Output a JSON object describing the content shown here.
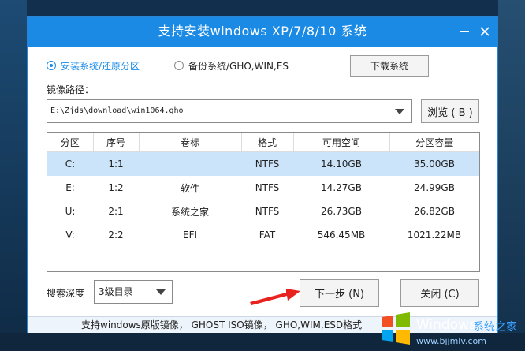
{
  "window": {
    "title": "支持安装windows XP/7/8/10 系统"
  },
  "options": {
    "restore_label": "安装系统/还原分区",
    "backup_label": "备份系统/GHO,WIN,ES",
    "selected": "restore",
    "download_button": "下载系统"
  },
  "image_path": {
    "label": "镜像路径：",
    "value": "E:\\Zjds\\download\\win1064.gho",
    "browse_button": "浏览 ( B )"
  },
  "table": {
    "headers": [
      "分区",
      "序号",
      "卷标",
      "格式",
      "可用空间",
      "分区容量"
    ],
    "rows": [
      [
        "C:",
        "1:1",
        "",
        "NTFS",
        "14.10GB",
        "35.00GB"
      ],
      [
        "E:",
        "1:2",
        "软件",
        "NTFS",
        "14.27GB",
        "24.99GB"
      ],
      [
        "U:",
        "2:1",
        "系统之家",
        "NTFS",
        "26.73GB",
        "26.82GB"
      ],
      [
        "V:",
        "2:2",
        "EFI",
        "FAT",
        "546.45MB",
        "1021.22MB"
      ]
    ],
    "selected_row": 0
  },
  "search": {
    "label": "搜索深度",
    "value": "3级目录"
  },
  "buttons": {
    "next": "下一步 (N)",
    "close": "关闭 (C)"
  },
  "footer": {
    "text": "支持windows原版镜像， GHOST ISO镜像， GHO,WIM,ESD格式"
  },
  "watermark": {
    "brand": "Windows",
    "site": "系统之家",
    "url": "www.bjjmlv.com"
  },
  "colors": {
    "accent": "#1a8ae5",
    "selection": "#cce4fa",
    "arrow": "#e8231f"
  },
  "icons": [
    "close-icon",
    "minimize-icon",
    "chevron-down-icon",
    "red-arrow-icon",
    "windows-logo-icon"
  ]
}
